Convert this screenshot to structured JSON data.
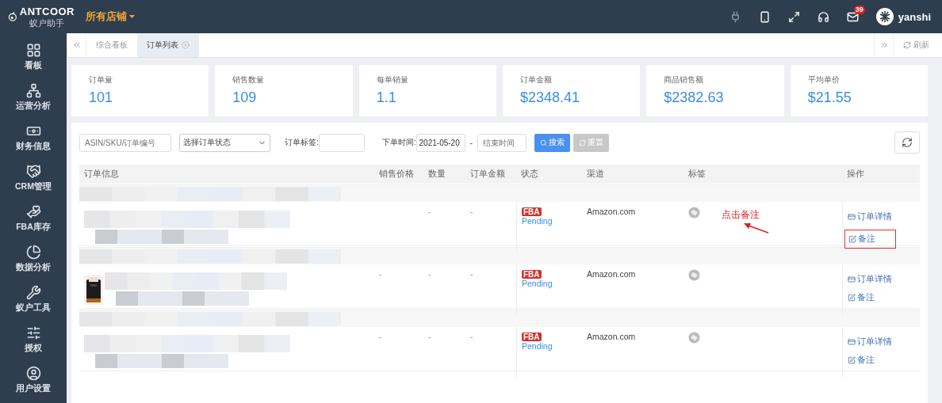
{
  "header": {
    "logo_text": "ANTCOOR",
    "logo_subtext": "蚁户助手",
    "store_selector": "所有店铺",
    "icons": [
      {
        "kind": "plug"
      },
      {
        "kind": "phone"
      },
      {
        "kind": "expand"
      },
      {
        "kind": "headset"
      },
      {
        "kind": "mail",
        "badge": "39"
      }
    ],
    "user": "yanshi"
  },
  "sidebar": {
    "items": [
      {
        "kind": "grid",
        "label": "看板"
      },
      {
        "kind": "network",
        "label": "运营分析"
      },
      {
        "kind": "money",
        "label": "财务信息"
      },
      {
        "kind": "handshake",
        "label": "CRM管理"
      },
      {
        "kind": "stock",
        "label": "FBA库存"
      },
      {
        "kind": "pie",
        "label": "数据分析"
      },
      {
        "kind": "tools",
        "label": "蚁户工具"
      },
      {
        "kind": "sliders",
        "label": "授权"
      },
      {
        "kind": "user",
        "label": "用户设置"
      }
    ]
  },
  "tabs": [
    {
      "label": "综合看板",
      "selected": false,
      "closable": false
    },
    {
      "label": "订单列表",
      "selected": true,
      "closable": true
    }
  ],
  "refresh": "刷新",
  "stats": [
    {
      "label": "订单量",
      "value": "101"
    },
    {
      "label": "销售数量",
      "value": "109"
    },
    {
      "label": "每单销量",
      "value": "1.1"
    },
    {
      "label": "订单金额",
      "value": "$2348.41"
    },
    {
      "label": "商品销售额",
      "value": "$2382.63"
    },
    {
      "label": "平均单价",
      "value": "$21.55"
    }
  ],
  "filters": {
    "search_placeholder": "ASIN/SKU/订单编号",
    "status_select": "选择订单状态",
    "tag_label": "订单标签:",
    "date_label": "下单时间:",
    "date_start": "2021-05-20",
    "date_separator": "-",
    "date_end_placeholder": "结束时间",
    "search_button": "搜索",
    "reset_button": {
      "label": "重置",
      "disabled": true
    }
  },
  "table": {
    "columns": [
      "订单信息",
      "销售价格",
      "数量",
      "订单金额",
      "状态",
      "渠道",
      "标签",
      "操作"
    ],
    "orders": [
      {
        "has_thumbnail": false,
        "qty": "-",
        "amount": "-",
        "badge": "FBA",
        "status": "Pending",
        "channel": "Amazon.com",
        "actions": [
          {
            "kind": "detail",
            "label": "订单详情",
            "highlighted": false
          },
          {
            "kind": "note",
            "label": "备注",
            "highlighted": true
          }
        ],
        "annotation": "点击备注"
      },
      {
        "has_thumbnail": true,
        "price": "-",
        "qty": "-",
        "amount": "-",
        "badge": "FBA",
        "status": "Pending",
        "channel": "Amazon.com",
        "actions": [
          {
            "kind": "detail",
            "label": "订单详情",
            "highlighted": false
          },
          {
            "kind": "note",
            "label": "备注",
            "highlighted": false
          }
        ]
      },
      {
        "has_thumbnail": false,
        "price": "-",
        "qty": "-",
        "amount": "-",
        "badge": "FBA",
        "status": "Pending",
        "channel": "Amazon.com",
        "actions": [
          {
            "kind": "detail",
            "label": "订单详情",
            "highlighted": false
          },
          {
            "kind": "note",
            "label": "备注",
            "highlighted": false
          }
        ]
      }
    ]
  }
}
